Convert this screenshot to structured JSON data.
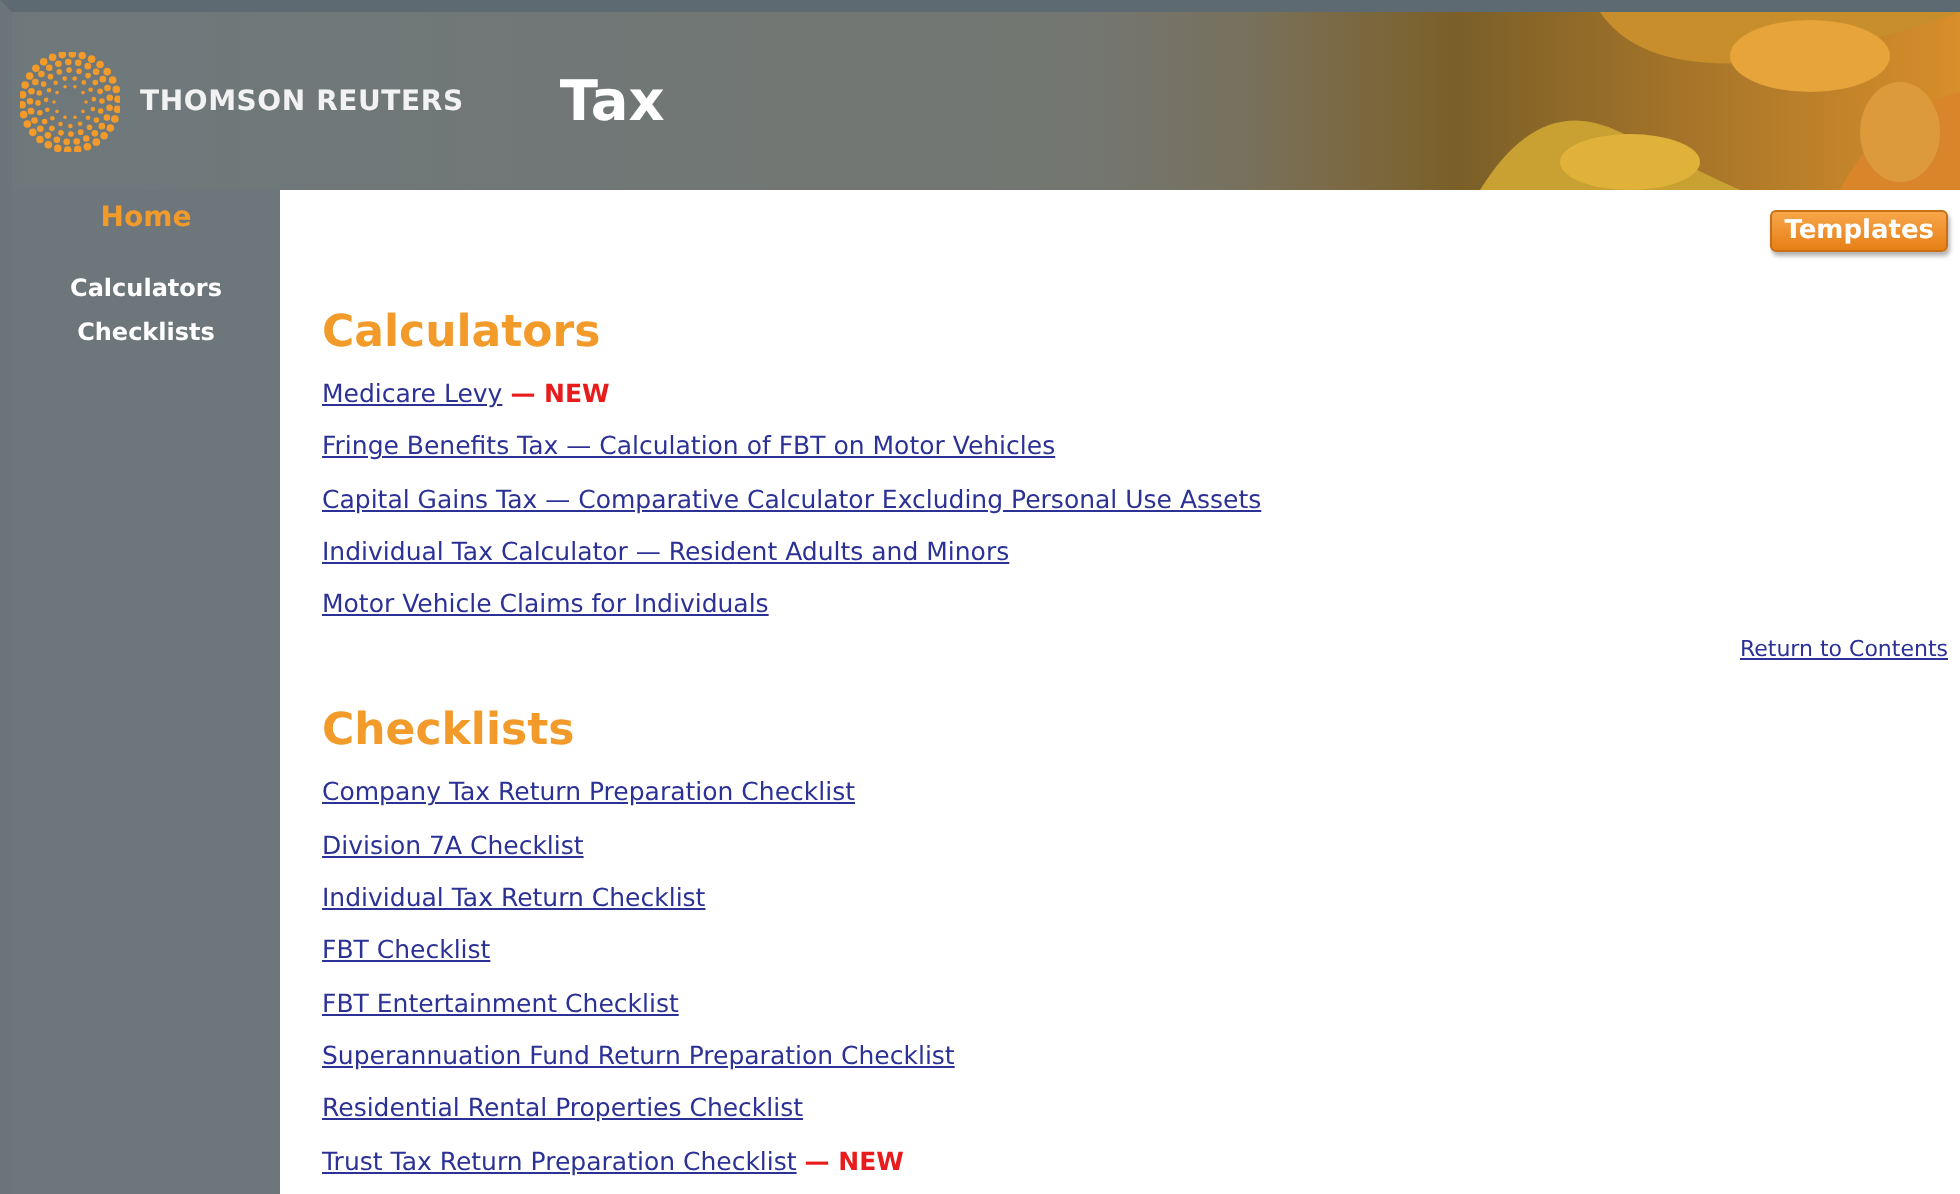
{
  "header": {
    "brand": "THOMSON REUTERS",
    "title": "Tax"
  },
  "sidebar": {
    "items": [
      {
        "label": "Home",
        "selected": true
      },
      {
        "label": "Calculators",
        "selected": false
      },
      {
        "label": "Checklists",
        "selected": false
      }
    ]
  },
  "toolbar": {
    "button": "Templates"
  },
  "sections": [
    {
      "heading": "Calculators",
      "links": [
        {
          "label": "Medicare Levy",
          "tag": "— NEW"
        },
        {
          "label": "Fringe Benefits Tax — Calculation of FBT on Motor Vehicles"
        },
        {
          "label": "Capital Gains Tax — Comparative Calculator Excluding Personal Use Assets"
        },
        {
          "label": "Individual Tax Calculator — Resident Adults and Minors"
        },
        {
          "label": "Motor Vehicle Claims for Individuals"
        }
      ],
      "footer_link": "Return to Contents"
    },
    {
      "heading": "Checklists",
      "links": [
        {
          "label": "Company Tax Return Preparation Checklist"
        },
        {
          "label": "Division 7A Checklist"
        },
        {
          "label": "Individual Tax Return Checklist"
        },
        {
          "label": "FBT Checklist"
        },
        {
          "label": "FBT Entertainment Checklist"
        },
        {
          "label": "Superannuation Fund Return Preparation Checklist"
        },
        {
          "label": "Residential Rental Properties Checklist"
        },
        {
          "label": "Trust Tax Return Preparation Checklist",
          "tag": "— NEW"
        }
      ]
    }
  ]
}
